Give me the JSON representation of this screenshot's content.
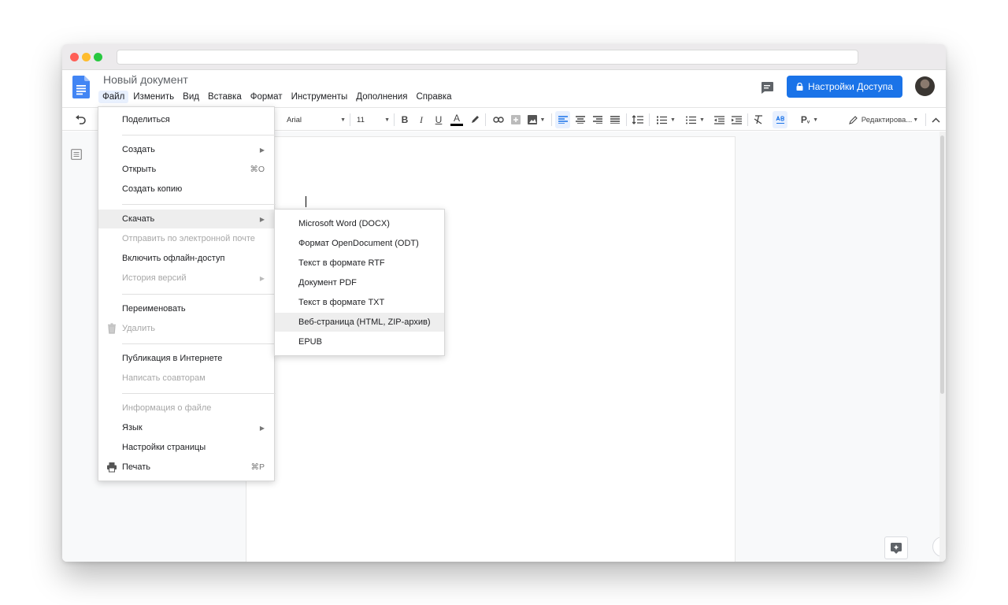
{
  "doc": {
    "title": "Новый документ"
  },
  "menubar": [
    "Файл",
    "Изменить",
    "Вид",
    "Вставка",
    "Формат",
    "Инструменты",
    "Дополнения",
    "Справка"
  ],
  "header": {
    "share_label": "Настройки Доступа"
  },
  "toolbar": {
    "font_name": "Arial",
    "font_size": "11",
    "text_color_glyph": "A",
    "bold": "B",
    "italic": "I",
    "underline": "U",
    "mode_label": "Редактирова..."
  },
  "file_menu": {
    "items": [
      {
        "label": "Поделиться"
      },
      {
        "label": "Создать",
        "submenu": true
      },
      {
        "label": "Открыть",
        "shortcut": "⌘O"
      },
      {
        "label": "Создать копию"
      },
      {
        "label": "Скачать",
        "submenu": true,
        "highlighted": true
      },
      {
        "label": "Отправить по электронной почте",
        "disabled": true
      },
      {
        "label": "Включить офлайн-доступ"
      },
      {
        "label": "История версий",
        "submenu": true,
        "disabled": true
      },
      {
        "label": "Переименовать"
      },
      {
        "label": "Удалить",
        "disabled": true,
        "icon": "trash-icon"
      },
      {
        "label": "Публикация в Интернете"
      },
      {
        "label": "Написать соавторам",
        "disabled": true
      },
      {
        "label": "Информация о файле",
        "disabled": true
      },
      {
        "label": "Язык",
        "submenu": true
      },
      {
        "label": "Настройки страницы"
      },
      {
        "label": "Печать",
        "shortcut": "⌘P",
        "icon": "printer-icon"
      }
    ]
  },
  "download_menu": {
    "items": [
      {
        "label": "Microsoft Word (DOCX)"
      },
      {
        "label": "Формат OpenDocument (ODT)"
      },
      {
        "label": "Текст в формате RTF"
      },
      {
        "label": "Документ PDF"
      },
      {
        "label": "Текст в формате TXT"
      },
      {
        "label": "Веб-страница (HTML, ZIP-архив)",
        "highlighted": true
      },
      {
        "label": "EPUB"
      }
    ]
  },
  "colors": {
    "accent": "#1a73e8",
    "docs_blue": "#4285f4",
    "menu_hover": "#eeeeee"
  }
}
